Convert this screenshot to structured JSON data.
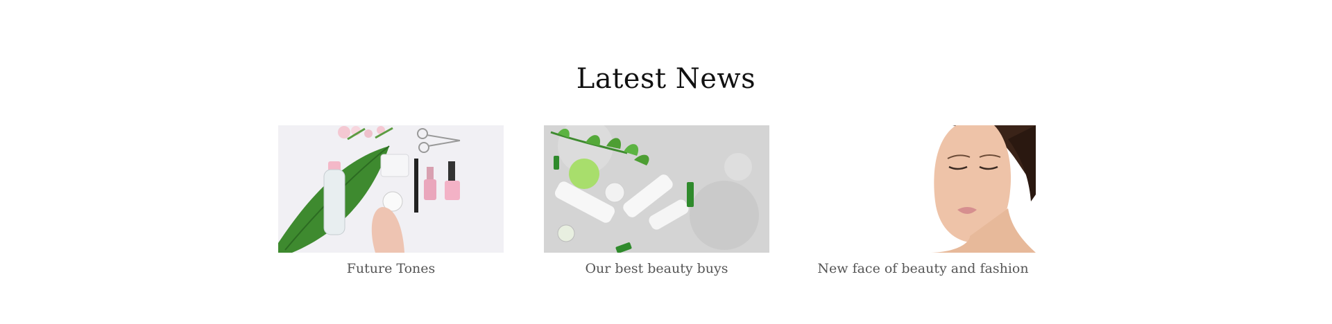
{
  "section": {
    "title": "Latest News"
  },
  "posts": [
    {
      "caption": "Future Tones",
      "image": "cosmetics-flatlay-image"
    },
    {
      "caption": "Our best beauty buys",
      "image": "skincare-tubes-image"
    },
    {
      "caption": "New face of beauty and fashion",
      "image": "woman-face-image"
    }
  ],
  "colors": {
    "heading": "#111111",
    "caption": "#555555",
    "leaf_green": "#3e8a2f",
    "background": "#ffffff"
  }
}
